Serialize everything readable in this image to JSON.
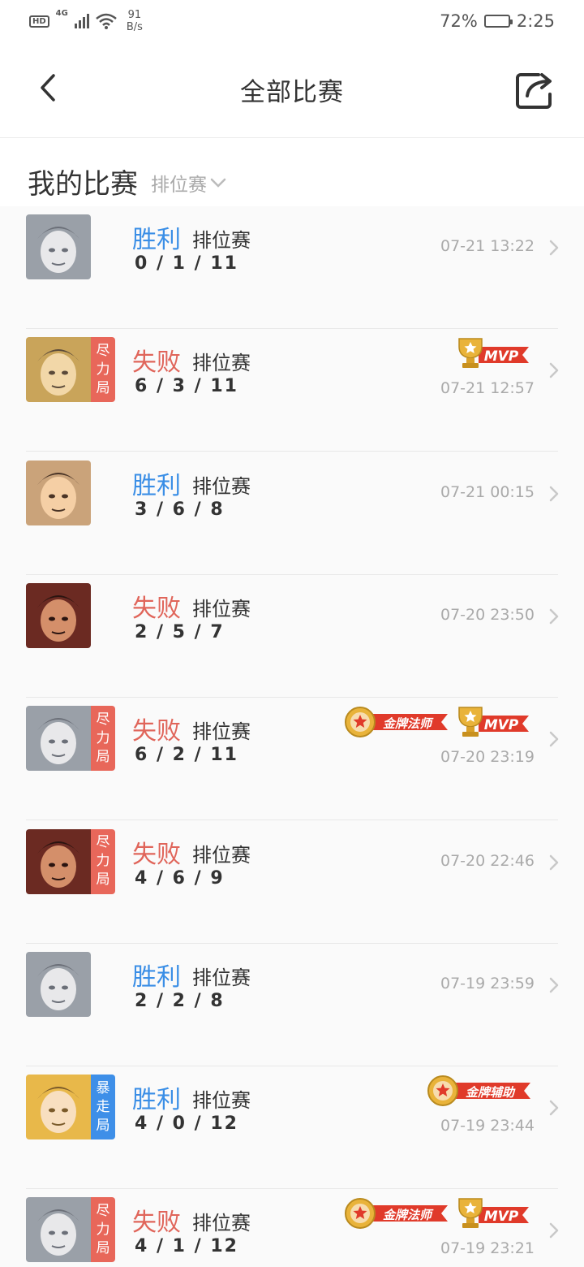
{
  "status_bar": {
    "hd": "HD",
    "network": "4G",
    "speed_value": "91",
    "speed_unit": "B/s",
    "battery_percent": "72%",
    "battery_level": 0.72,
    "time": "2:25"
  },
  "nav": {
    "title": "全部比赛"
  },
  "section": {
    "title": "我的比赛",
    "filter": "排位赛"
  },
  "badges": {
    "mvp": "MVP",
    "gold_mage": "金牌法师",
    "gold_support": "金牌辅助"
  },
  "colors": {
    "win": "#3a8ee6",
    "loss": "#e0655a",
    "tag_red": "#e8675a",
    "tag_blue": "#3e8fe8"
  },
  "matches": [
    {
      "result": "胜利",
      "mode": "排位赛",
      "kda": "0/1/11",
      "time": "07-21 13:22",
      "tag": ""
    },
    {
      "result": "失败",
      "mode": "排位赛",
      "kda": "6/3/11",
      "time": "07-21 12:57",
      "tag": "尽力局",
      "tag_chars": [
        "尽",
        "力",
        "局"
      ]
    },
    {
      "result": "胜利",
      "mode": "排位赛",
      "kda": "3/6/8",
      "time": "07-21 00:15",
      "tag": ""
    },
    {
      "result": "失败",
      "mode": "排位赛",
      "kda": "2/5/7",
      "time": "07-20 23:50",
      "tag": ""
    },
    {
      "result": "失败",
      "mode": "排位赛",
      "kda": "6/2/11",
      "time": "07-20 23:19",
      "tag": "尽力局",
      "tag_chars": [
        "尽",
        "力",
        "局"
      ]
    },
    {
      "result": "失败",
      "mode": "排位赛",
      "kda": "4/6/9",
      "time": "07-20 22:46",
      "tag": "尽力局",
      "tag_chars": [
        "尽",
        "力",
        "局"
      ]
    },
    {
      "result": "胜利",
      "mode": "排位赛",
      "kda": "2/2/8",
      "time": "07-19 23:59",
      "tag": ""
    },
    {
      "result": "胜利",
      "mode": "排位赛",
      "kda": "4/0/12",
      "time": "07-19 23:44",
      "tag": "暴走局",
      "tag_chars": [
        "暴",
        "走",
        "局"
      ]
    },
    {
      "result": "失败",
      "mode": "排位赛",
      "kda": "4/1/12",
      "time": "07-19 23:21",
      "tag": "尽力局",
      "tag_chars": [
        "尽",
        "力",
        "局"
      ]
    }
  ]
}
